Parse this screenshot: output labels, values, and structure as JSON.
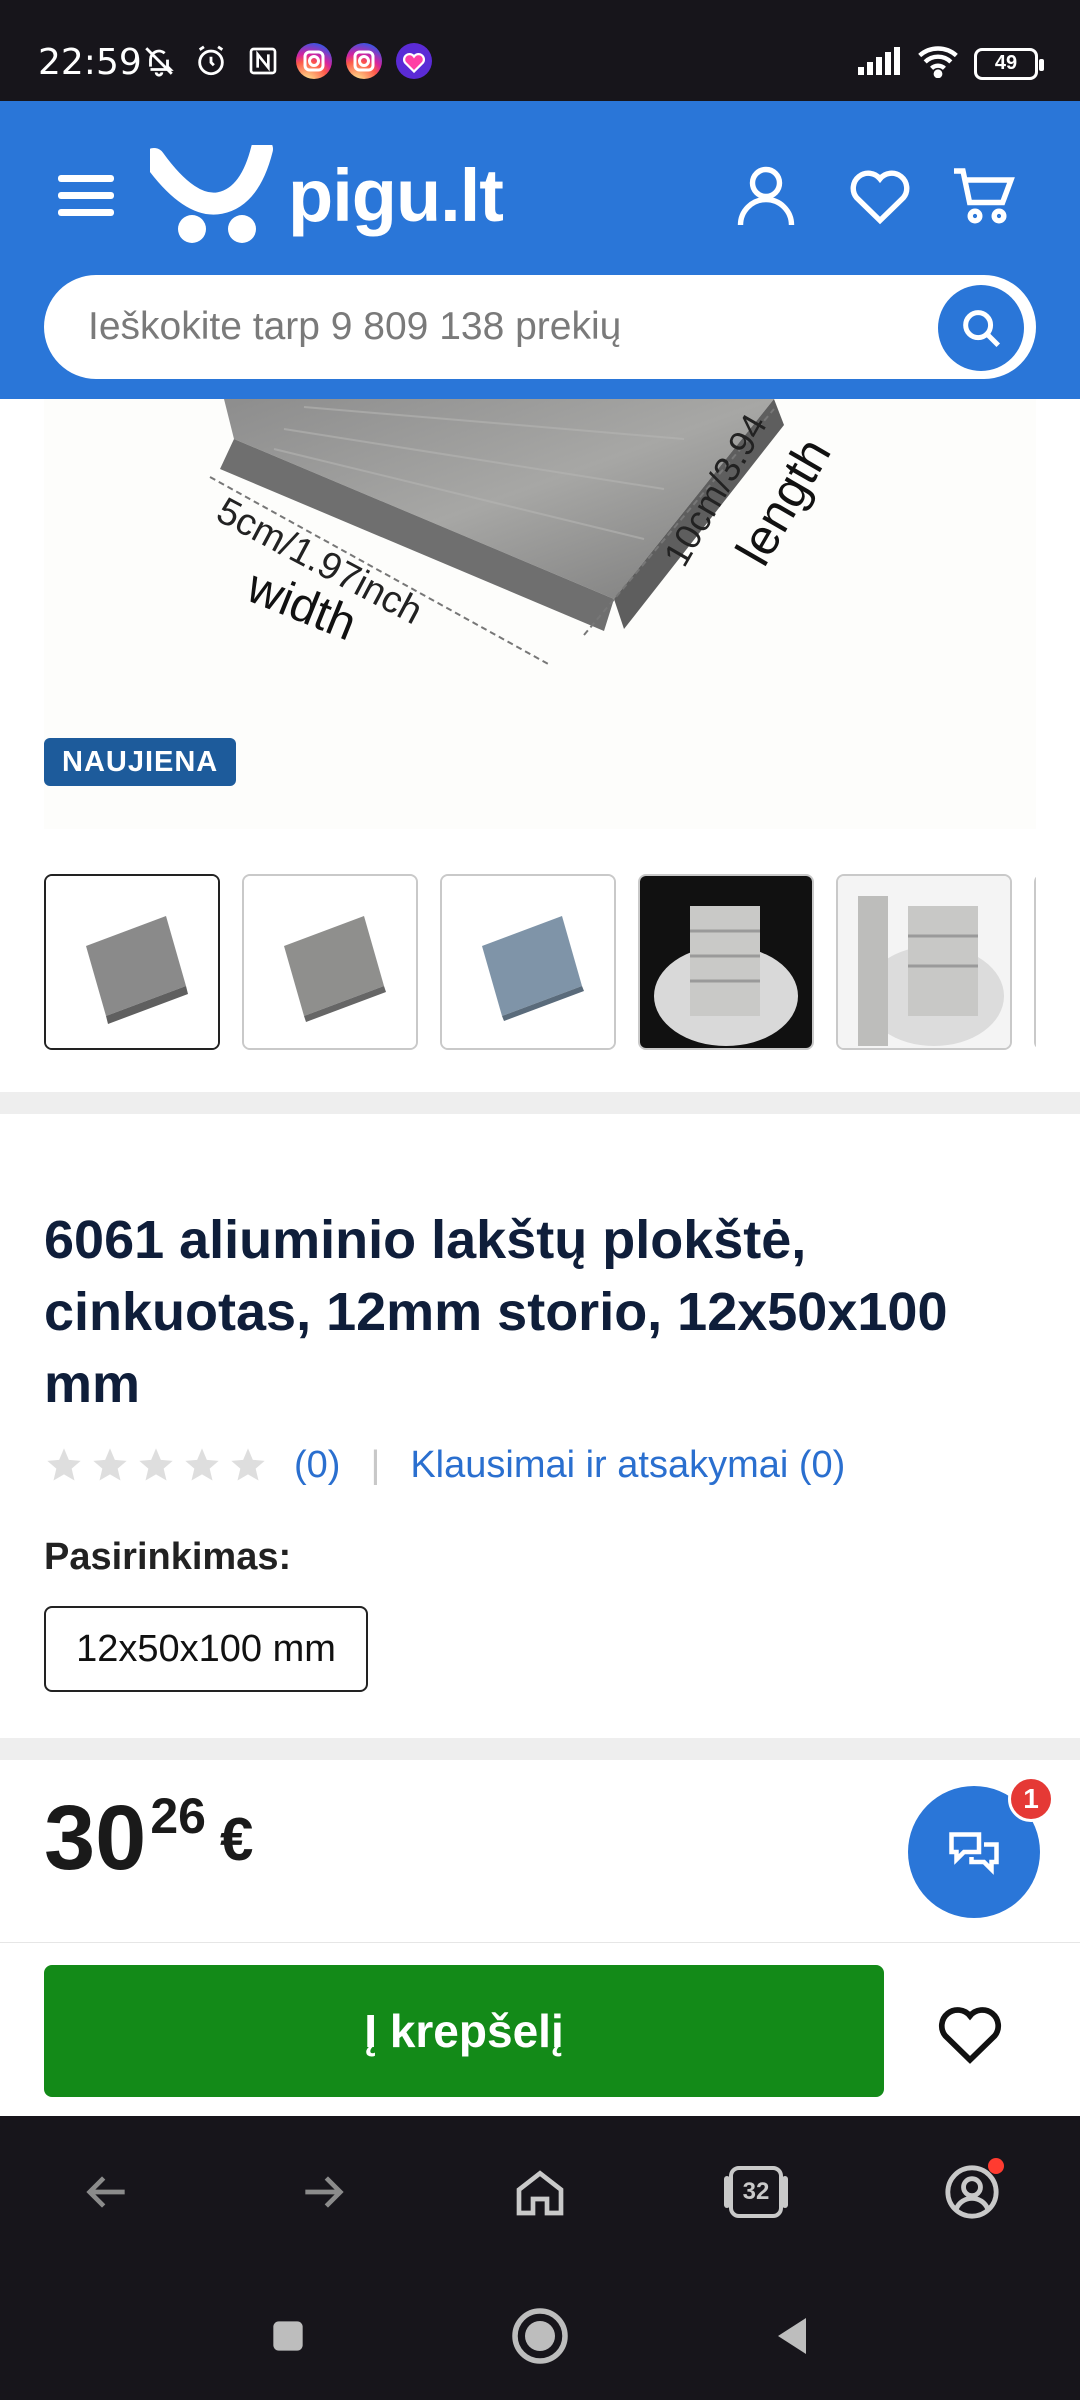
{
  "status_bar": {
    "time": "22:59",
    "battery": "49"
  },
  "header": {
    "logo_text": "pigu.lt",
    "search_placeholder": "Ieškokite tarp 9 809 138 prekių"
  },
  "product": {
    "badge": "NAUJIENA",
    "image_labels": {
      "width_value": "5cm/1.97inch",
      "width_word": "width",
      "length_value": "10cm/3.94",
      "length_word": "length"
    },
    "title": "6061 aliuminio lakštų plokštė, cinkuotas, 12mm storio, 12x50x100 mm",
    "rating_stars": 0,
    "rating_count": "(0)",
    "separator": "|",
    "qa_link": "Klausimai ir atsakymai (0)",
    "variant_label": "Pasirinkimas:",
    "variant_value": "12x50x100 mm",
    "price_int": "30",
    "price_dec": "26",
    "currency": "€"
  },
  "chat": {
    "badge_count": "1"
  },
  "actions": {
    "add_to_cart": "Į krepšelį"
  },
  "browser": {
    "tabs_count": "32"
  },
  "colors": {
    "brand_blue": "#2a76d8",
    "cart_green": "#138a18",
    "badge_blue": "#1d5b9b",
    "link_blue": "#2a6fcf"
  }
}
